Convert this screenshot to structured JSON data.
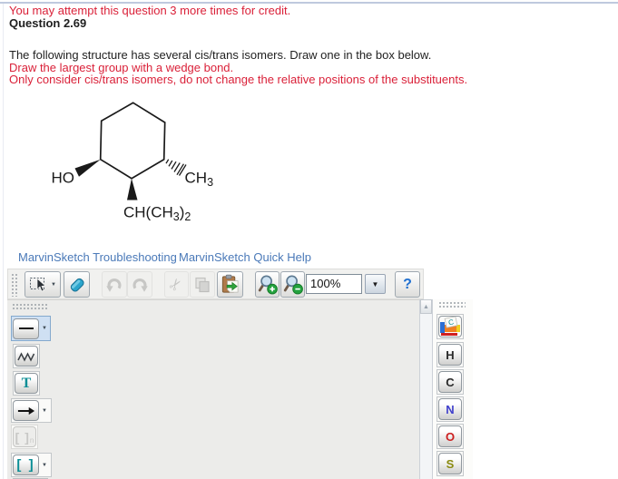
{
  "header": {
    "attempt_notice": "You may attempt this question 3 more times for credit.",
    "question_title": "Question 2.69",
    "instruction": "The following structure has several cis/trans isomers. Draw one in the box below.",
    "hint_wedge": "Draw the largest group with a wedge bond.",
    "hint_cis_trans": "Only consider cis/trans isomers, do not change the relative positions of the substituents."
  },
  "structure": {
    "ho_label": "HO",
    "ch3": {
      "main": "CH",
      "sub": "3"
    },
    "isopropyl": {
      "p1": "CH(CH",
      "s1": "3",
      "p2": ")",
      "s2": "2"
    }
  },
  "links": {
    "troubleshooting": "MarvinSketch Troubleshooting",
    "quick_help": "MarvinSketch Quick Help"
  },
  "toolbar": {
    "zoom_value": "100%",
    "help_glyph": "?"
  },
  "icons": {
    "dropdown": "▼",
    "scroll_up": "▲",
    "scissors": "✂"
  },
  "left_palette": {
    "text_tool": "T",
    "group_tool": {
      "brackets": "[ ]",
      "sub": "n"
    },
    "bracket_tool": "[ ]"
  },
  "right_palette": {
    "periodic_label": "C",
    "elements": [
      {
        "symbol": "H"
      },
      {
        "symbol": "C"
      },
      {
        "symbol": "N"
      },
      {
        "symbol": "O"
      },
      {
        "symbol": "S"
      }
    ]
  },
  "colors": {
    "red_text": "#da2139",
    "link_blue": "#4a79b8",
    "tool_teal": "#0b8e96",
    "element_n": "#4040cc",
    "element_o": "#cc2020",
    "element_s": "#8a8a10",
    "selected_tool_bg": "#cfe0f3",
    "canvas_bg": "#ececea"
  }
}
